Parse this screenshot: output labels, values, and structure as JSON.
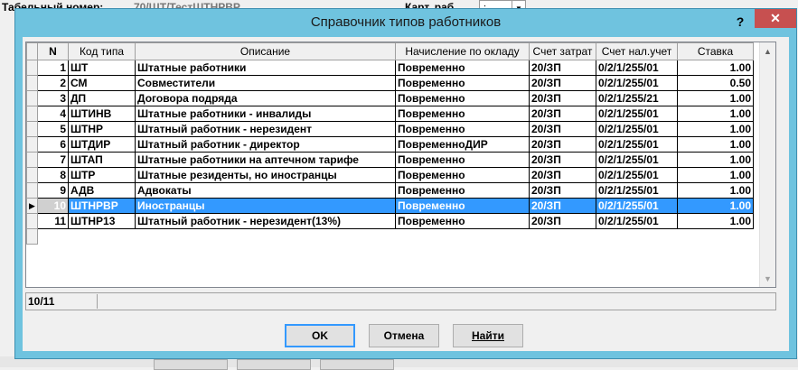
{
  "background": {
    "tabnum_label": "Табельный номер:",
    "tabnum_value": "70/ШТ/ТестШТНРВР",
    "card_label": "Карт. раб.",
    "card_value": ":"
  },
  "dialog": {
    "title": "Справочник типов работников",
    "help_label": "?",
    "close_label": "✕"
  },
  "grid": {
    "columns": [
      "N",
      "Код типа",
      "Описание",
      "Начисление по окладу",
      "Счет затрат",
      "Счет нал.учет",
      "Ставка"
    ],
    "rows": [
      {
        "n": "1",
        "code": "ШТ",
        "desc": "Штатные работники",
        "accrual": "Повременно",
        "cost": "20/ЗП",
        "tax": "0/2/1/255/01",
        "rate": "1.00"
      },
      {
        "n": "2",
        "code": "СМ",
        "desc": "Совместители",
        "accrual": "Повременно",
        "cost": "20/ЗП",
        "tax": "0/2/1/255/01",
        "rate": "0.50"
      },
      {
        "n": "3",
        "code": "ДП",
        "desc": "Договора подряда",
        "accrual": "Повременно",
        "cost": "20/ЗП",
        "tax": "0/2/1/255/21",
        "rate": "1.00"
      },
      {
        "n": "4",
        "code": "ШТИНВ",
        "desc": "Штатные работники - инвалиды",
        "accrual": "Повременно",
        "cost": "20/ЗП",
        "tax": "0/2/1/255/01",
        "rate": "1.00"
      },
      {
        "n": "5",
        "code": "ШТНР",
        "desc": "Штатный работник - нерезидент",
        "accrual": "Повременно",
        "cost": "20/ЗП",
        "tax": "0/2/1/255/01",
        "rate": "1.00"
      },
      {
        "n": "6",
        "code": "ШТДИР",
        "desc": "Штатный работник - директор",
        "accrual": "ПовременноДИР",
        "cost": "20/ЗП",
        "tax": "0/2/1/255/01",
        "rate": "1.00"
      },
      {
        "n": "7",
        "code": "ШТАП",
        "desc": "Штатные работники на аптечном тарифе",
        "accrual": "Повременно",
        "cost": "20/ЗП",
        "tax": "0/2/1/255/01",
        "rate": "1.00"
      },
      {
        "n": "8",
        "code": "ШТР",
        "desc": "Штатные резиденты, но иностранцы",
        "accrual": "Повременно",
        "cost": "20/ЗП",
        "tax": "0/2/1/255/01",
        "rate": "1.00"
      },
      {
        "n": "9",
        "code": "АДВ",
        "desc": "Адвокаты",
        "accrual": "Повременно",
        "cost": "20/ЗП",
        "tax": "0/2/1/255/01",
        "rate": "1.00"
      },
      {
        "n": "10",
        "code": "ШТНРВР",
        "desc": "Иностранцы",
        "accrual": "Повременно",
        "cost": "20/ЗП",
        "tax": "0/2/1/255/01",
        "rate": "1.00",
        "selected": true
      },
      {
        "n": "11",
        "code": "ШТНР13",
        "desc": "Штатный работник - нерезидент(13%)",
        "accrual": "Повременно",
        "cost": "20/ЗП",
        "tax": "0/2/1/255/01",
        "rate": "1.00"
      }
    ],
    "current_row_marker": "▶"
  },
  "status": {
    "position": "10/11"
  },
  "buttons": {
    "ok": "OK",
    "cancel": "Отмена",
    "find": "Найти"
  },
  "colors": {
    "titlebar": "#6fc3df",
    "selection": "#3399ff",
    "close": "#c75050"
  }
}
